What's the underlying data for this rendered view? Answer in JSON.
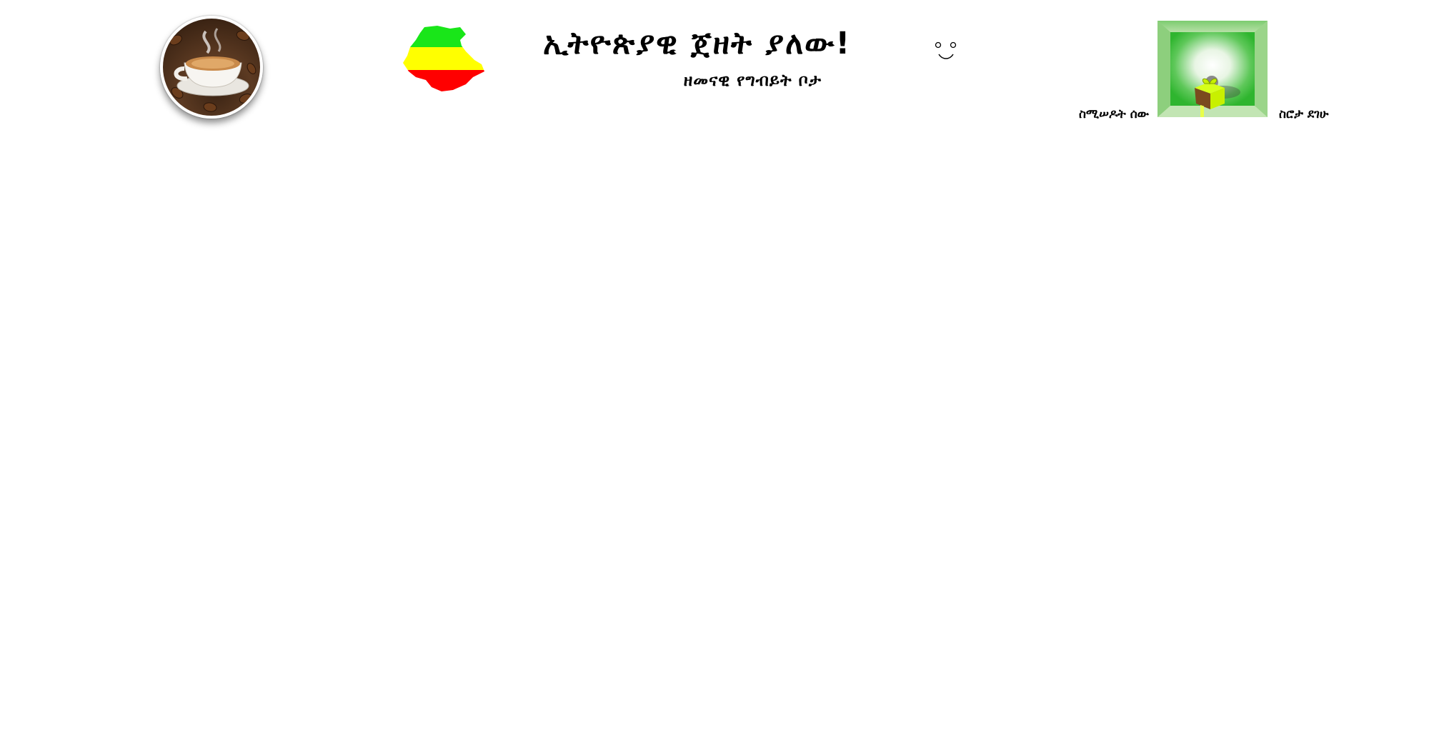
{
  "header": {
    "title": "ኢትዮጵያዊ ጀዘት ያለው!",
    "subtitle": "ዘመናዊ የግብይት ቦታ",
    "smiley_text": "◦‿◦",
    "left_link": "ስሚሠዶት ሰው",
    "right_link": "ስሮታ ደገሁ"
  },
  "icons": {
    "coffee_logo": "coffee-cup-icon",
    "map": "ethiopia-flag-map-icon",
    "smiley": "smiley-face-icon",
    "gift": "gift-box-icon"
  },
  "colors": {
    "flag_green": "#19e619",
    "flag_yellow": "#ffff00",
    "flag_red": "#ff0000",
    "panel_green": "#2fb52f",
    "gift_lime": "#c8f000",
    "gift_brown": "#7a4a1e"
  }
}
